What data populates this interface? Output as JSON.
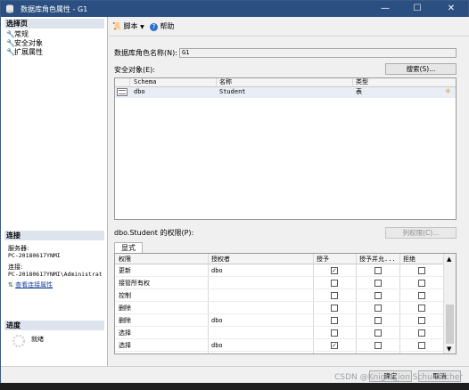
{
  "window": {
    "title": "数据库角色属性 - G1",
    "minimize": "—",
    "maximize": "☐",
    "close": "✕"
  },
  "left": {
    "select_page_header": "选择页",
    "pages": [
      {
        "label": "常规",
        "icon": "wrench-icon"
      },
      {
        "label": "安全对象",
        "icon": "wrench-icon"
      },
      {
        "label": "扩展属性",
        "icon": "wrench-icon"
      }
    ],
    "connection_header": "连接",
    "server_label": "服务器:",
    "server_value": "PC-20180617YNMI",
    "connection_label": "连接:",
    "connection_value": "PC-20180617YNMI\\Administrat",
    "view_connection_properties": "查看连接属性",
    "progress_header": "进度",
    "progress_status": "就绪"
  },
  "toolbar": {
    "script_label": "脚本",
    "help_label": "帮助"
  },
  "form": {
    "role_name_label": "数据库角色名称(N):",
    "role_name_value": "G1",
    "securables_label": "安全对象(E):",
    "search_button": "搜索(S)...",
    "securables_columns": [
      "Schema",
      "名称",
      "类型"
    ],
    "securables_rows": [
      {
        "schema": "dbo",
        "name": "Student",
        "type": "表"
      }
    ],
    "permissions_label": "dbo.Student 的权限(P):",
    "column_permissions_button": "列权限(C)...",
    "tab_explicit": "显式",
    "permissions_columns": [
      "权限",
      "授权者",
      "授予",
      "授予并允...",
      "拒绝"
    ],
    "permissions_rows": [
      {
        "permission": "更新",
        "grantor": "dbo",
        "grant": true,
        "with_grant": false,
        "deny": false
      },
      {
        "permission": "接管所有权",
        "grantor": "",
        "grant": false,
        "with_grant": false,
        "deny": false
      },
      {
        "permission": "控制",
        "grantor": "",
        "grant": false,
        "with_grant": false,
        "deny": false
      },
      {
        "permission": "删除",
        "grantor": "",
        "grant": false,
        "with_grant": false,
        "deny": false
      },
      {
        "permission": "删除",
        "grantor": "dbo",
        "grant": false,
        "with_grant": false,
        "deny": false
      },
      {
        "permission": "选择",
        "grantor": "",
        "grant": false,
        "with_grant": false,
        "deny": false
      },
      {
        "permission": "选择",
        "grantor": "dbo",
        "grant": true,
        "with_grant": false,
        "deny": false
      }
    ]
  },
  "footer": {
    "ok_button": "确定",
    "cancel_button": "取消",
    "watermark": "CSDN @Knight_ion Schumacher"
  }
}
